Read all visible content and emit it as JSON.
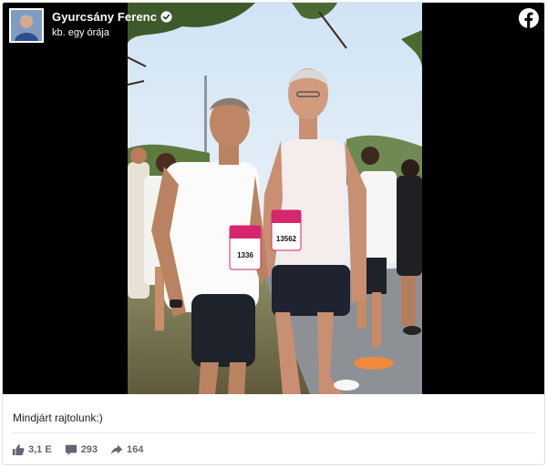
{
  "post": {
    "author": {
      "name": "Gyurcsány Ferenc",
      "verified": true,
      "timestamp": "kb. egy órája"
    },
    "caption": "Mindjárt rajtolunk:)",
    "photo": {
      "bib_left": "1336",
      "bib_right": "13562"
    },
    "stats": {
      "reactions": "3,1 E",
      "comments": "293",
      "shares": "164"
    }
  },
  "icons": {
    "brand": "facebook-icon",
    "verified": "verified-badge-icon",
    "reactions": "like-icon",
    "comments": "comment-icon",
    "shares": "share-icon"
  },
  "colors": {
    "facebook_white": "#ffffff",
    "media_background": "#000000",
    "meta_text": "#606770",
    "bib_pink": "#d6266e"
  }
}
